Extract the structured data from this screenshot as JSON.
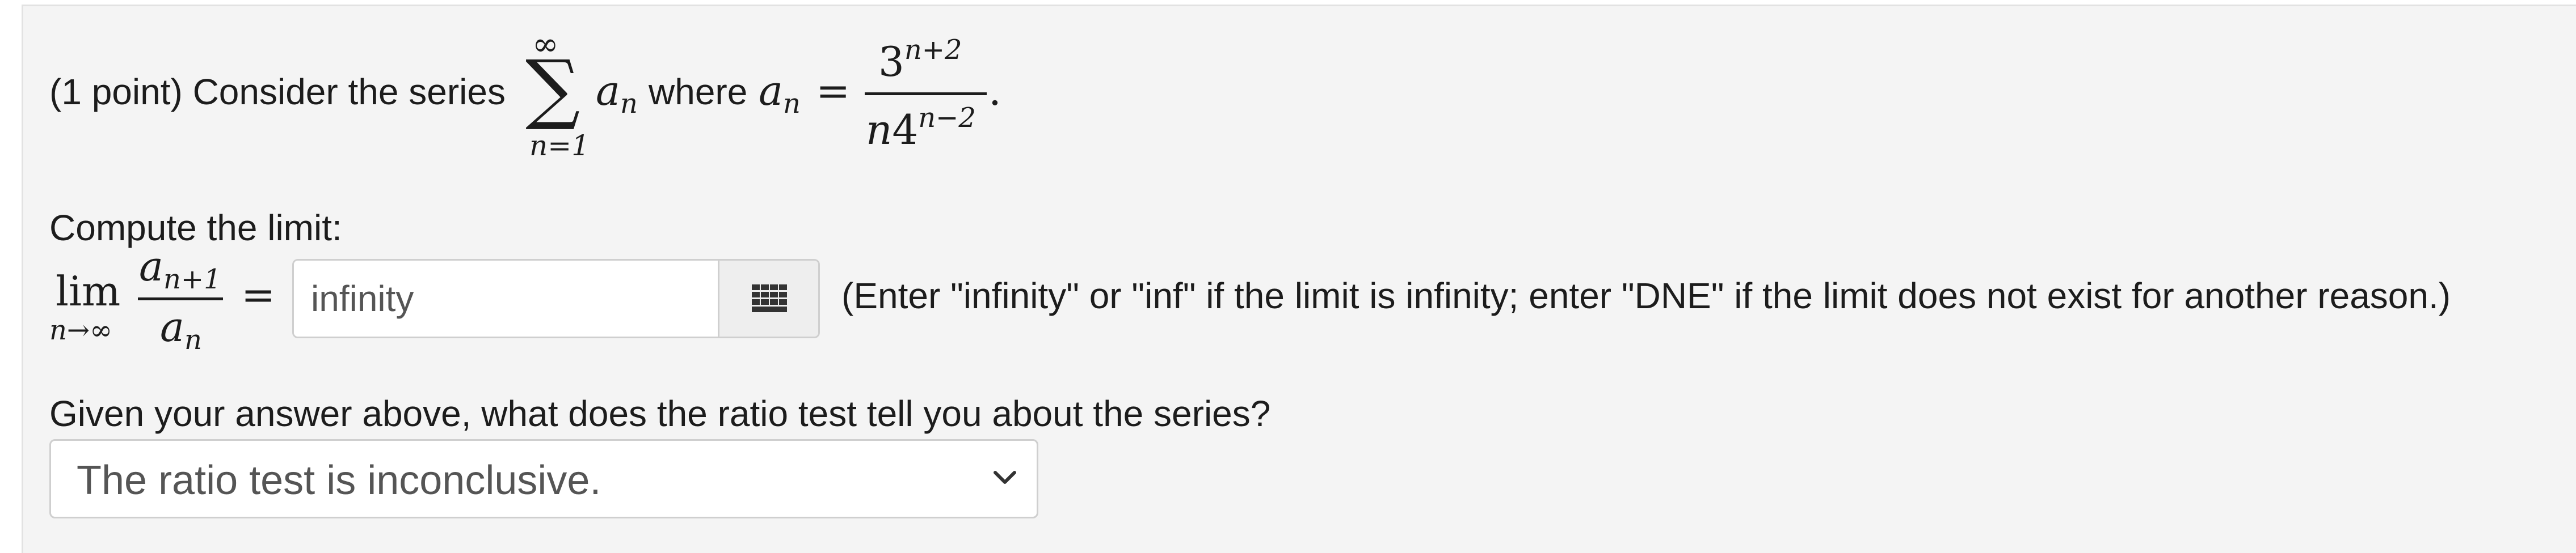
{
  "question": {
    "points_label": "(1 point) Consider the series",
    "sum_upper": "∞",
    "sum_symbol": "∑",
    "sum_lower": "n=1",
    "term": "a",
    "term_sub": "n",
    "where_label": "where",
    "equals": "=",
    "numerator_base": "3",
    "numerator_exp": "n+2",
    "denominator_n": "n",
    "denominator_base": "4",
    "denominator_exp": "n−2",
    "period": "."
  },
  "limit": {
    "label": "Compute the limit:",
    "lim_word": "lim",
    "lim_sub": "n→∞",
    "top_var": "a",
    "top_sub": "n+1",
    "bottom_var": "a",
    "bottom_sub": "n",
    "equals": "=",
    "answer_value": "infinity",
    "palette_icon": "grid-icon",
    "hint": "(Enter \"infinity\" or \"inf\" if the limit is infinity; enter \"DNE\" if the limit does not exist for another reason.)"
  },
  "ratio_test": {
    "question": "Given your answer above, what does the ratio test tell you about the series?",
    "selected_option": "The ratio test is inconclusive.",
    "chevron_icon": "chevron-down-icon"
  }
}
